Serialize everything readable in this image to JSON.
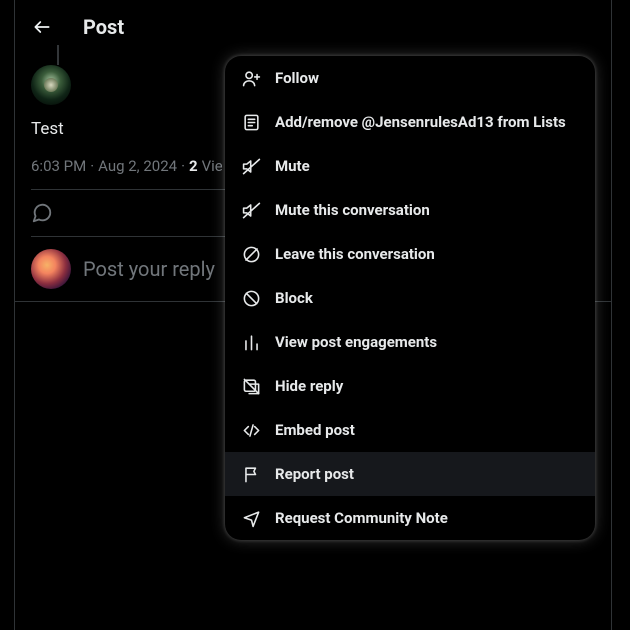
{
  "header": {
    "title": "Post"
  },
  "post": {
    "body": "Test",
    "time": "6:03 PM",
    "date": "Aug 2, 2024",
    "views_num": "2",
    "views_label": "Views"
  },
  "reply": {
    "placeholder": "Post your reply"
  },
  "menu": {
    "items": [
      {
        "icon": "follow-icon",
        "label": "Follow"
      },
      {
        "icon": "list-icon",
        "label": "Add/remove @JensenrulesAd13 from Lists"
      },
      {
        "icon": "mute-icon",
        "label": "Mute"
      },
      {
        "icon": "mute-convo-icon",
        "label": "Mute this conversation"
      },
      {
        "icon": "leave-convo-icon",
        "label": "Leave this conversation"
      },
      {
        "icon": "block-icon",
        "label": "Block"
      },
      {
        "icon": "engagements-icon",
        "label": "View post engagements"
      },
      {
        "icon": "hide-reply-icon",
        "label": "Hide reply"
      },
      {
        "icon": "embed-icon",
        "label": "Embed post"
      },
      {
        "icon": "report-icon",
        "label": "Report post",
        "hover": true
      },
      {
        "icon": "community-note-icon",
        "label": "Request Community Note"
      }
    ]
  }
}
